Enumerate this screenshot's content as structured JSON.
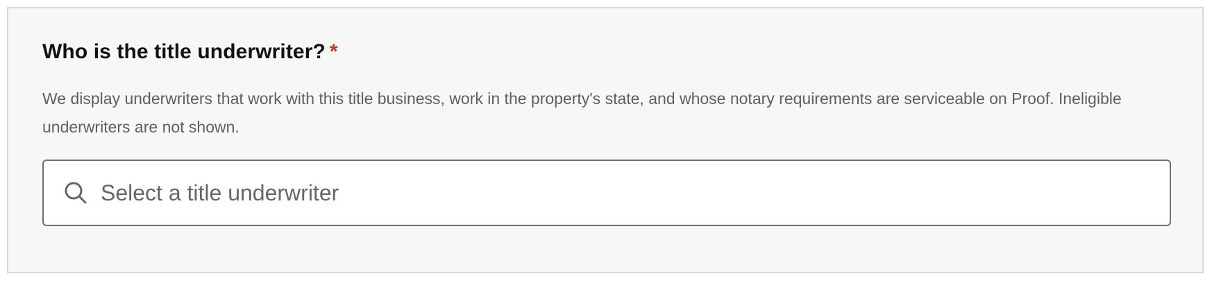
{
  "question": {
    "label": "Who is the title underwriter?",
    "required_marker": "*"
  },
  "help_text": "We display underwriters that work with this title business, work in the property's state, and whose notary requirements are serviceable on Proof. Ineligible underwriters are not shown.",
  "underwriter_select": {
    "placeholder": "Select a title underwriter",
    "value": "",
    "icon": "search-icon"
  },
  "colors": {
    "required": "#c0392b",
    "text": "#111111",
    "muted": "#5f5f5f",
    "border": "#6f6f6f",
    "card_bg": "#f7f7f7"
  }
}
